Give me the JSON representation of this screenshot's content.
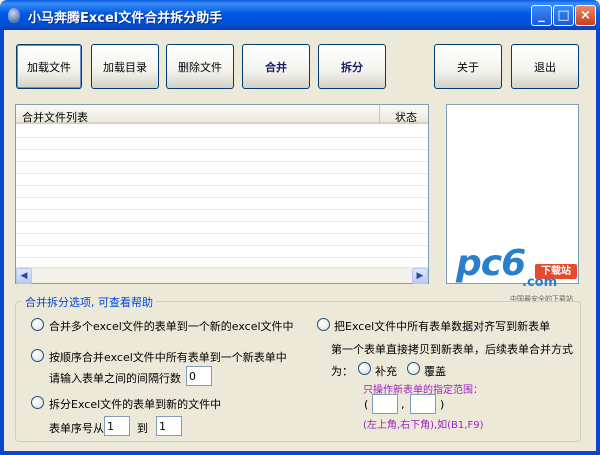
{
  "window": {
    "title": "小马奔腾Excel文件合并拆分助手"
  },
  "title_buttons": {
    "minimize": "_",
    "maximize": "□",
    "close": "×"
  },
  "toolbar": {
    "load_file": "加载文件",
    "load_dir": "加载目录",
    "delete_file": "删除文件",
    "merge": "合并",
    "split": "拆分",
    "about": "关于",
    "exit": "退出"
  },
  "file_list": {
    "columns": [
      "合并文件列表",
      "状态"
    ],
    "rows": []
  },
  "scroll_arrows": {
    "left": "◀",
    "right": "▶"
  },
  "watermark": {
    "brand": "pc6",
    "domain": ".com",
    "badge": "下载站",
    "slogan": "中国最安全的下载站"
  },
  "options": {
    "legend": "合并拆分选项, 可查看帮助",
    "opt1": "合并多个excel文件的表单到一个新的excel文件中",
    "opt2": "按顺序合并excel文件中所有表单到一个新表单中",
    "opt2_gap_label": "请输入表单之间的间隔行数",
    "opt2_gap_value": "0",
    "opt3": "拆分Excel文件的表单到新的文件中",
    "opt3_seq_label": "表单序号从",
    "opt3_from": "1",
    "opt3_to_label": "到",
    "opt3_to": "1",
    "opt4": "把Excel文件中所有表单数据对齐写到新表单",
    "opt4_desc": "第一个表单直接拷贝到新表单，后续表单合并方式",
    "opt4_mode_label": "为：",
    "opt4_mode_fill": "补充",
    "opt4_mode_cover": "覆盖",
    "range_hint": "只操作新表单的指定范围：",
    "range_open": "(",
    "range_comma": ",",
    "range_close": ")",
    "range_start": "",
    "range_end": "",
    "range_example": "(左上角,右下角),如(B1,F9)"
  }
}
